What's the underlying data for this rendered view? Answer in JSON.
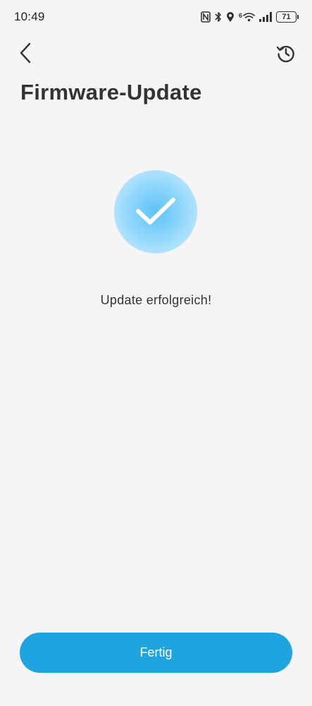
{
  "status_bar": {
    "time": "10:49",
    "network_label": "6",
    "battery": "71"
  },
  "header": {
    "title": "Firmware-Update",
    "back_icon": "chevron-left-icon",
    "history_icon": "history-icon"
  },
  "main": {
    "success_icon": "checkmark-icon",
    "message": "Update erfolgreich!"
  },
  "footer": {
    "done_label": "Fertig"
  },
  "colors": {
    "background": "#f5f5f5",
    "accent": "#1ea5e0",
    "circle": "#8fd6fb"
  }
}
